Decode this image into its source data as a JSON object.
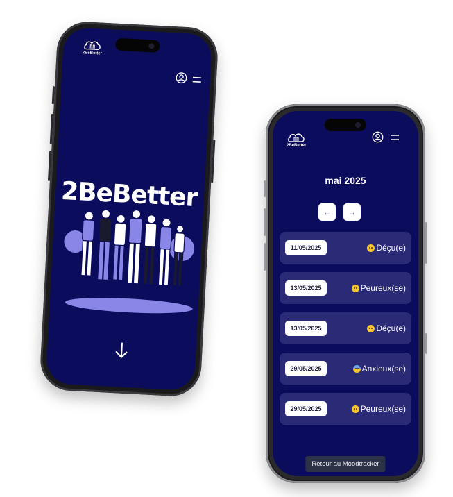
{
  "left_phone": {
    "logo_text": "2BeBetter",
    "hero_title": "2BeBetter",
    "icons": [
      "user-circle-icon",
      "menu-icon",
      "arrow-down-icon"
    ]
  },
  "right_phone": {
    "logo_text": "2BeBetter",
    "month": "mai 2025",
    "prev_label": "←",
    "next_label": "→",
    "entries": [
      {
        "date": "11/05/2025",
        "mood": "Déçu(e)",
        "emoji": "disappointed"
      },
      {
        "date": "13/05/2025",
        "mood": "Peureux(se)",
        "emoji": "fearful"
      },
      {
        "date": "13/05/2025",
        "mood": "Déçu(e)",
        "emoji": "disappointed"
      },
      {
        "date": "29/05/2025",
        "mood": "Anxieux(se)",
        "emoji": "anxious"
      },
      {
        "date": "29/05/2025",
        "mood": "Peureux(se)",
        "emoji": "fearful"
      }
    ],
    "return_button": "Retour au Moodtracker"
  },
  "colors": {
    "screen_bg": "#0c0c5c",
    "card_bg": "#2a2a77",
    "accent_illustration": "#8a86e8",
    "button_dark": "#2c3346"
  }
}
